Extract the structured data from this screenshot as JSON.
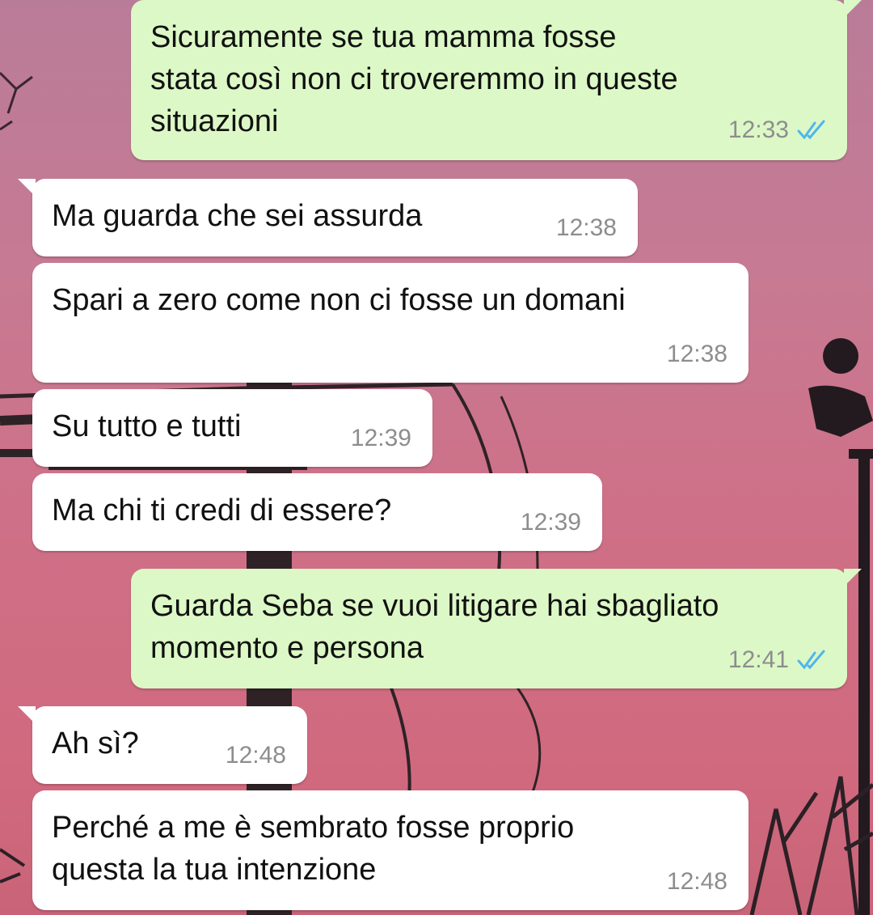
{
  "chat": {
    "messages": [
      {
        "direction": "outgoing",
        "text": "Sicuramente se tua mamma fosse\nstata così non ci troveremmo in queste\nsituazioni",
        "time": "12:33",
        "status_icon": "double-check-read-icon"
      },
      {
        "direction": "incoming",
        "text": "Ma guarda che sei assurda",
        "time": "12:38"
      },
      {
        "direction": "incoming",
        "text": "Spari a zero come non ci fosse un domani",
        "time": "12:38"
      },
      {
        "direction": "incoming",
        "text": "Su tutto e tutti",
        "time": "12:39"
      },
      {
        "direction": "incoming",
        "text": "Ma chi ti credi di essere?",
        "time": "12:39"
      },
      {
        "direction": "outgoing",
        "text": "Guarda Seba se vuoi litigare hai sbagliato\nmomento e persona",
        "time": "12:41",
        "status_icon": "double-check-read-icon"
      },
      {
        "direction": "incoming",
        "text": "Ah sì?",
        "time": "12:48"
      },
      {
        "direction": "incoming",
        "text": "Perché a me è sembrato fosse proprio\nquesta la tua intenzione",
        "time": "12:48"
      }
    ]
  },
  "colors": {
    "incoming_bubble": "#ffffff",
    "outgoing_bubble": "#dcf8c6",
    "read_ticks": "#4fb6ec",
    "timestamp": "#8d8d8d"
  }
}
